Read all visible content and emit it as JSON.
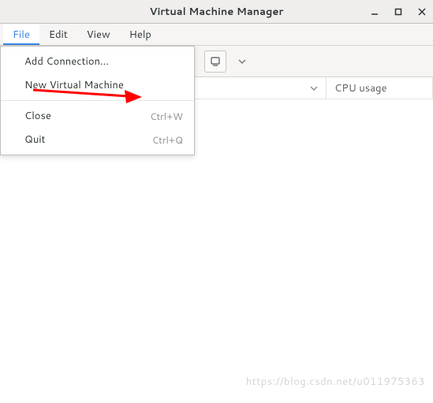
{
  "titlebar": {
    "title": "Virtual Machine Manager"
  },
  "menubar": {
    "items": [
      {
        "label": "File",
        "active": true
      },
      {
        "label": "Edit"
      },
      {
        "label": "View"
      },
      {
        "label": "Help"
      }
    ]
  },
  "dropdown": {
    "items": [
      {
        "label": "Add Connection...",
        "shortcut": ""
      },
      {
        "label": "New Virtual Machine",
        "shortcut": ""
      },
      {
        "label": "Close",
        "shortcut": "Ctrl+W"
      },
      {
        "label": "Quit",
        "shortcut": "Ctrl+Q"
      }
    ]
  },
  "columns": {
    "cpu": "CPU usage"
  },
  "watermark": "https://blog.csdn.net/u011975363"
}
